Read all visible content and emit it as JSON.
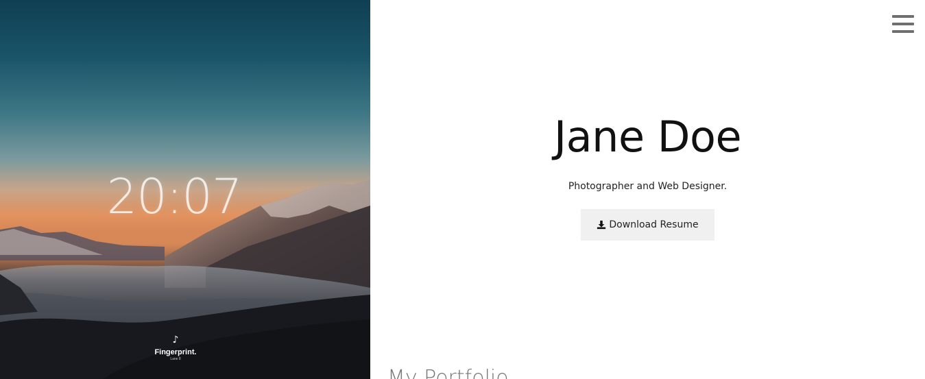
{
  "hero": {
    "clock": "20:07",
    "album": {
      "icon": "music-note-icon",
      "title": "Fingerprint.",
      "artist": "Lane 8"
    }
  },
  "header": {
    "menu_icon": "hamburger-menu-icon"
  },
  "intro": {
    "name": "Jane Doe",
    "tagline": "Photographer and Web Designer.",
    "download_label": "Download Resume",
    "download_icon": "download-icon"
  },
  "portfolio": {
    "heading": "My Portfolio"
  },
  "colors": {
    "button_bg": "#f0f0f0",
    "menu_icon": "#6f6f6f",
    "heading_text": "#111111"
  }
}
